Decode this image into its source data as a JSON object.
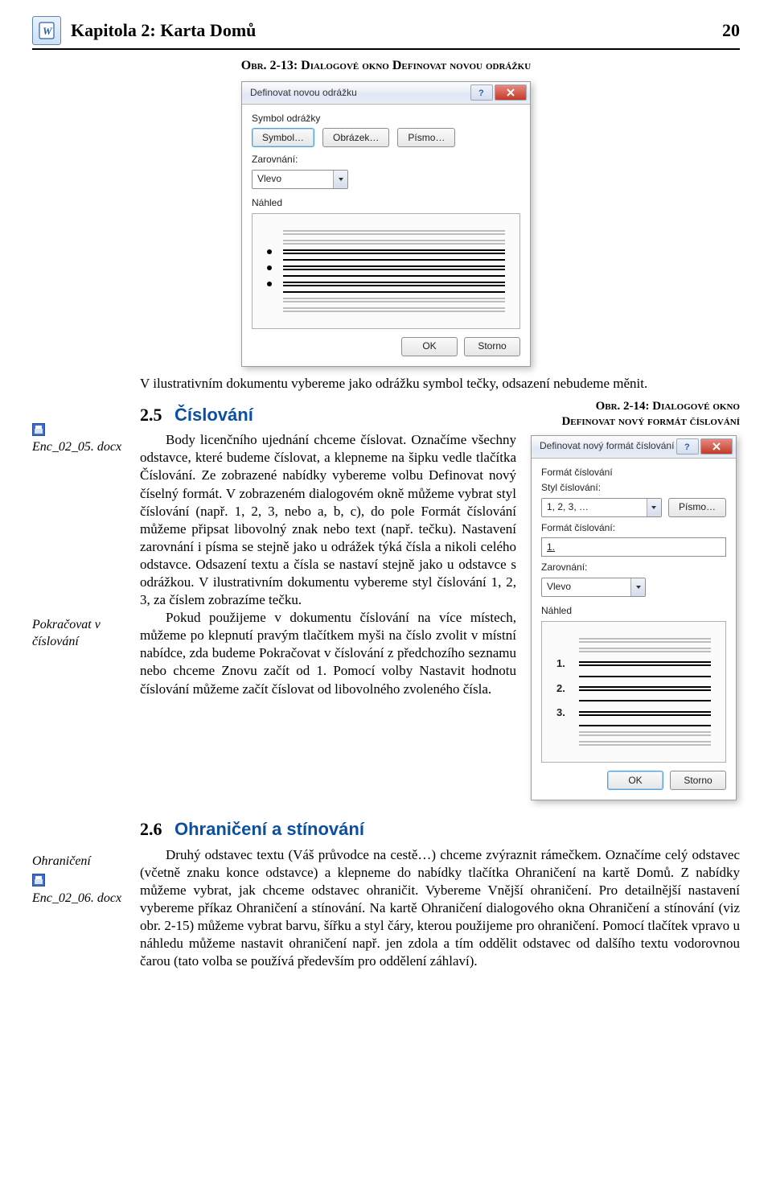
{
  "header": {
    "title": "Kapitola 2: Karta Domů",
    "page": "20"
  },
  "fig1_caption": "Obr. 2-13: Dialogové okno Definovat novou odrážku",
  "dialog1": {
    "title": "Definovat novou odrážku",
    "group1": "Symbol odrážky",
    "btn_symbol": "Symbol…",
    "btn_image": "Obrázek…",
    "btn_font": "Písmo…",
    "align_label": "Zarovnání:",
    "align_value": "Vlevo",
    "preview_label": "Náhled",
    "ok": "OK",
    "cancel": "Storno"
  },
  "intro": "V ilustrativním dokumentu vybereme jako odrážku symbol tečky, odsazení nebudeme měnit.",
  "sect25_num": "2.5",
  "sect25_title": "Číslování",
  "fig2_caption_l1": "Obr. 2-14: Dialogové okno",
  "fig2_caption_l2": "Definovat nový formát číslování",
  "margin1_file": "Enc_02_05. docx",
  "margin2": "Pokračovat v číslování",
  "body25_p1": "Body licenčního ujednání chceme číslovat. Označíme všechny odstavce, které budeme číslovat, a klepneme na šipku vedle tlačítka Číslování. Ze zobrazené nabídky vybereme volbu Definovat nový číselný formát. V zobrazeném dialogovém okně můžeme vybrat styl číslování (např. 1, 2, 3, nebo a, b, c), do pole Formát číslování můžeme připsat libovolný znak nebo text (např. tečku). Nastavení zarovnání i písma se stejně jako u odrážek týká čísla a nikoli celého odstavce. Odsazení textu a čísla se nastaví stejně jako u odstavce s odrážkou. V ilustrativním dokumentu vybereme styl číslování 1, 2, 3, za číslem zobrazíme tečku.",
  "body25_p2": "Pokud použijeme v dokumentu číslování na více místech, můžeme po klepnutí pravým tlačítkem myši na číslo zvolit v místní nabídce, zda budeme Pokračovat v číslování z předchozího seznamu nebo chceme Znovu začít od 1. Pomocí volby Nastavit hodnotu číslování můžeme začít číslovat od libovolného zvoleného čísla.",
  "dialog2": {
    "title": "Definovat nový formát číslování",
    "group": "Formát číslování",
    "style_label": "Styl číslování:",
    "style_value": "1, 2, 3, …",
    "btn_font": "Písmo…",
    "format_label": "Formát číslování:",
    "format_value": "1.",
    "align_label": "Zarovnání:",
    "align_value": "Vlevo",
    "preview_label": "Náhled",
    "n1": "1.",
    "n2": "2.",
    "n3": "3.",
    "ok": "OK",
    "cancel": "Storno"
  },
  "sect26_num": "2.6",
  "sect26_title": "Ohraničení a stínování",
  "margin3": "Ohraničení",
  "margin3_file": "Enc_02_06. docx",
  "body26": "Druhý odstavec textu (Váš průvodce na cestě…) chceme zvýraznit rámečkem. Označíme celý odstavec (včetně znaku konce odstavce) a klepneme do nabídky tlačítka Ohraničení na kartě Domů. Z nabídky můžeme vybrat, jak chceme odstavec ohraničit. Vybereme Vnější ohraničení. Pro detailnější nastavení vybereme příkaz Ohraničení a stínování. Na kartě Ohraničení dialogového okna Ohraničení a stínování (viz obr. 2-15) můžeme vybrat barvu, šířku a styl čáry, kterou použijeme pro ohraničení. Pomocí tlačítek vpravo u náhledu můžeme nastavit ohraničení např. jen zdola a tím oddělit odstavec od dalšího textu vodorovnou čarou (tato volba se používá především pro oddělení záhlaví)."
}
